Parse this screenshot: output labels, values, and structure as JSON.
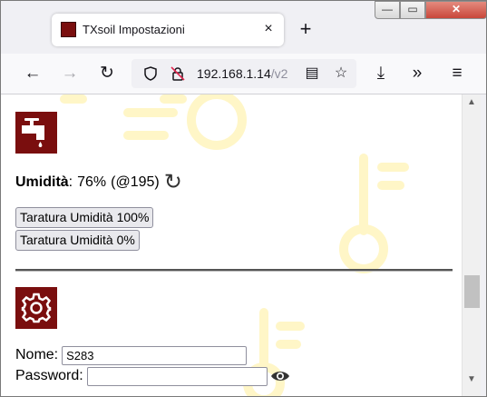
{
  "browser": {
    "tab_title": "TXsoil Impostazioni",
    "tab_close": "×",
    "new_tab": "+",
    "url_host": "192.168.1.14",
    "url_rest": "/v2",
    "window_buttons": {
      "minimize": "—",
      "maximize": "▭",
      "close": "✕"
    },
    "nav_icons": {
      "back": "←",
      "forward": "→",
      "reload": "↻",
      "reader": "▤",
      "bookmark": "☆",
      "downloads": "⤓",
      "overflow": "»",
      "menu": "≡"
    }
  },
  "page": {
    "humidity": {
      "label": "Umidità",
      "separator": ":",
      "value": "76%",
      "raw": "(@195)",
      "refresh_icon": "↻",
      "calibrate_100": "Taratura Umidità 100%",
      "calibrate_0": "Taratura Umidità 0%"
    },
    "settings": {
      "name_label": "Nome:",
      "name_value": "S283",
      "password_label": "Password:",
      "password_value": "",
      "eye_icon": "👁"
    }
  },
  "colors": {
    "accent": "#7a0e0e",
    "watermark": "#fff6c7"
  }
}
